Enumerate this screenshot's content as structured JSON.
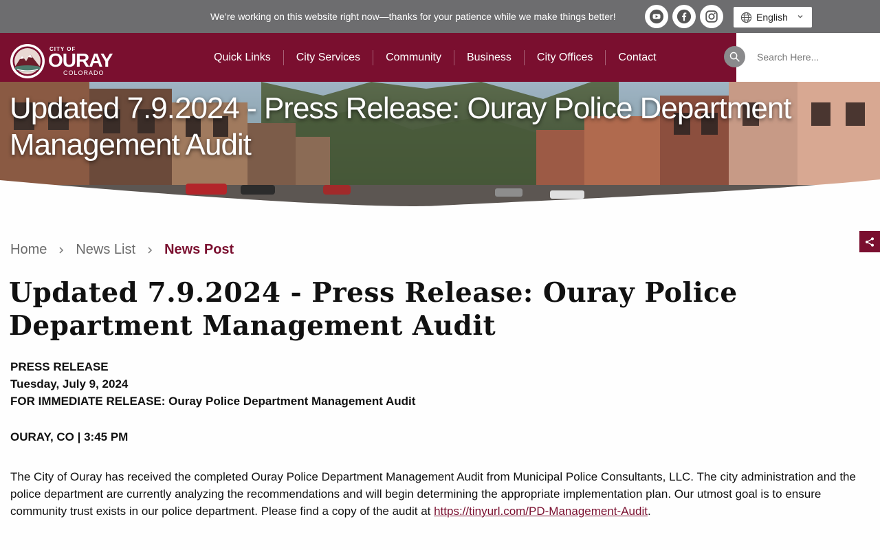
{
  "announcement": "We’re working on this website right now—thanks for your patience while we make things better!",
  "social": [
    {
      "name": "youtube-icon"
    },
    {
      "name": "facebook-icon"
    },
    {
      "name": "instagram-icon"
    }
  ],
  "language": {
    "selected": "English"
  },
  "logo": {
    "line1": "CITY OF",
    "line2": "OURAY",
    "line3": "COLORADO"
  },
  "nav": [
    "Quick Links",
    "City Services",
    "Community",
    "Business",
    "City Offices",
    "Contact"
  ],
  "search": {
    "placeholder": "Search Here..."
  },
  "hero": {
    "title": "Updated 7.9.2024 - Press Release: Ouray Police Department Management Audit"
  },
  "breadcrumb": [
    "Home",
    "News List",
    "News Post"
  ],
  "article": {
    "title": "Updated 7.9.2024 - Press Release: Ouray Police Department Management Audit",
    "meta_line1": "PRESS RELEASE",
    "meta_line2": "Tuesday, July 9, 2024",
    "meta_line3": "FOR IMMEDIATE RELEASE: Ouray Police Department Management Audit",
    "dateline": "OURAY, CO | 3:45 PM",
    "paragraph": "The City of Ouray has received the completed Ouray Police Department Management Audit from Municipal Police Consultants, LLC. The city administration and the police department are currently analyzing the recommendations and will begin determining the appropriate implementation plan. Our utmost goal is to ensure community trust exists in our police department. Please find a copy of the audit at ",
    "link_text": "https://tinyurl.com/PD-Management-Audit",
    "paragraph_end": "."
  },
  "colors": {
    "brand": "#7a0f2f",
    "topbar": "#6d6d6f"
  }
}
